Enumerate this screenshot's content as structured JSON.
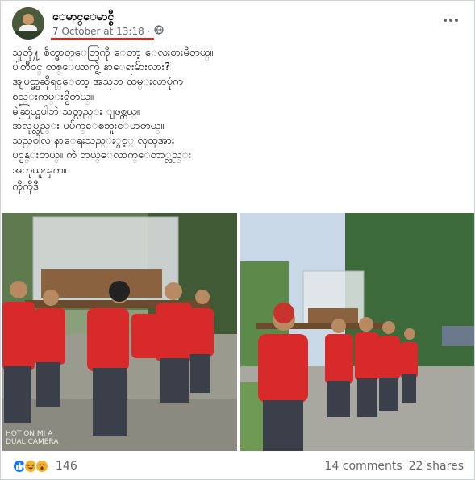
{
  "post": {
    "author": "ေမာင္ေမာင္စီ",
    "timestamp": "7 October at 13:18",
    "separator": "·",
    "privacy_icon": "globe-icon",
    "more_icon": "more-options-icon",
    "lines": [
      "သူတို႔ စိတ္ဓာတ္ေတြကို ေတာ့ ေလးစားမိတယ္။",
      "ပါတီ၀င္ တစ္ေယာက္ရဲ့ နာေရးမ်ားလား?",
      "အျပင္မွာဆိုရင္ေတာ့ အသုဘ ထမ္းလာပုံက",
      "စည္းကမ္းရွိတယ္။",
      "မဲဆြယ္မပါဘဲ သတ္လည္း ျဖစ္တယ္။",
      "အလုပ္လည္း မပ်က္ေစဘူးေမာတယ္။",
      "သည္ဝါလ နာေရးသည္ႏွင့္ လူထုအား",
      "ပင္ပန္းတယ္။ ကဲ ဘယ္ေလာက္ေတာ္လည္း",
      "အတုယူၾက။"
    ],
    "signoff": "ကိုကိုဒီ"
  },
  "photos": {
    "left_watermark_line1": "HOT ON MI A",
    "left_watermark_line2": "DUAL CAMERA"
  },
  "footer": {
    "reaction_icons": [
      "like-icon",
      "haha-icon",
      "wow-icon"
    ],
    "reaction_count": "146",
    "comments": "14 comments",
    "shares": "22 shares"
  },
  "colors": {
    "accent_underline": "#e02424",
    "shirt_red": "#d82a2a",
    "meta_gray": "#65676b",
    "like_blue": "#1877f2"
  }
}
